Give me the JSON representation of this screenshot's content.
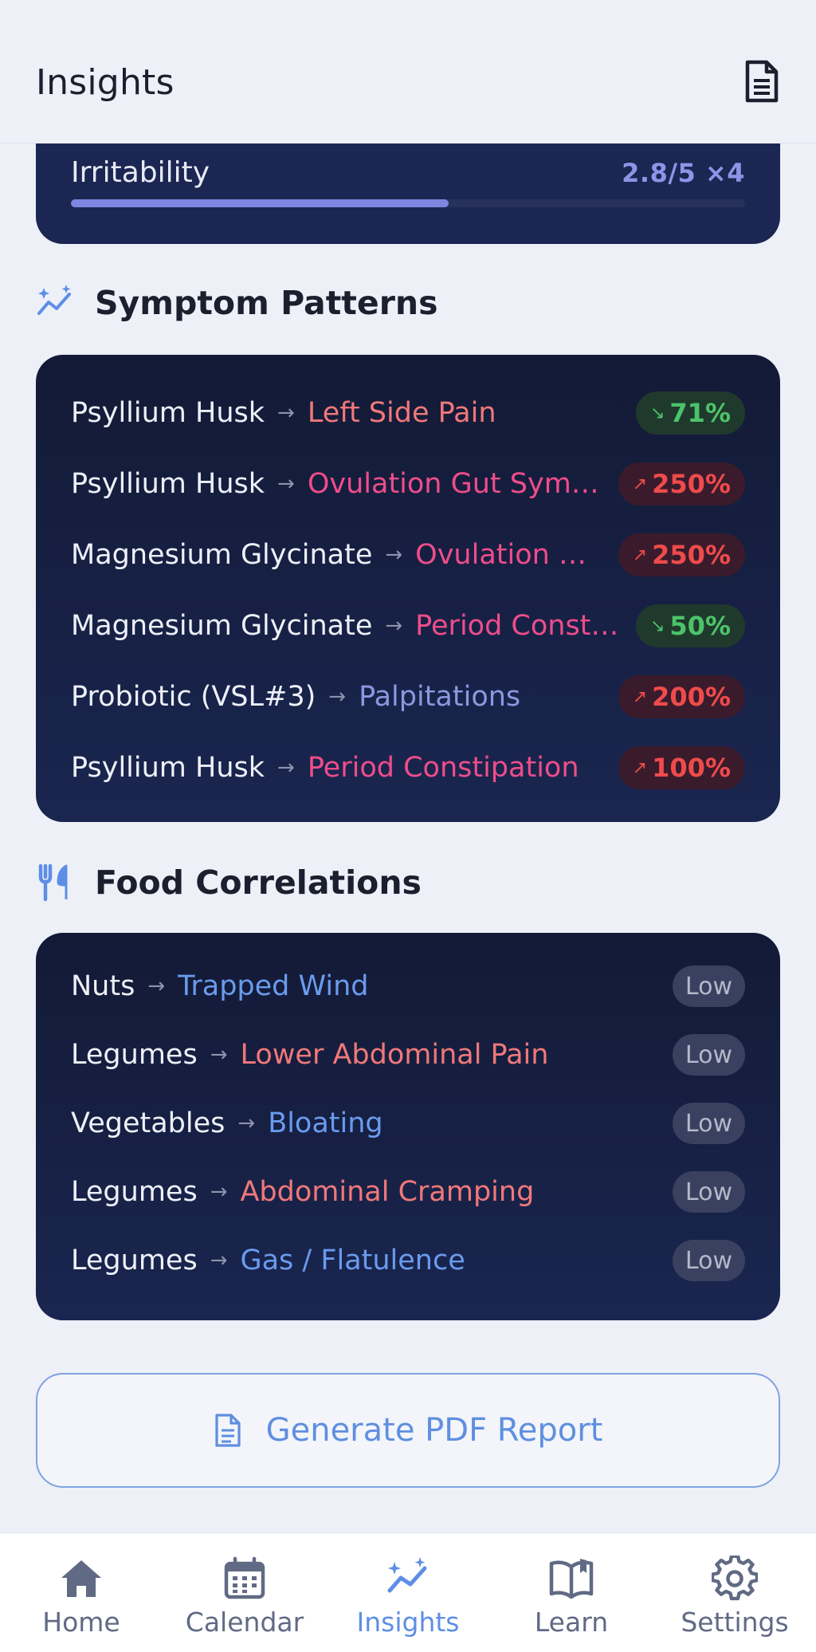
{
  "header": {
    "title": "Insights",
    "report_icon": "document-icon"
  },
  "mood_card": {
    "label": "Irritability",
    "value": "2.8/5 ×4",
    "progress_fraction": 0.56
  },
  "symptom_patterns": {
    "title": "Symptom Patterns",
    "icon": "sparkle-trend-icon",
    "rows": [
      {
        "source": "Psyllium Husk",
        "target": "Left Side Pain",
        "change": "71%",
        "direction": "down",
        "target_color": "#f0787a"
      },
      {
        "source": "Psyllium Husk",
        "target": "Ovulation Gut Symp...",
        "change": "250%",
        "direction": "up",
        "target_color": "#ee4d8a"
      },
      {
        "source": "Magnesium Glycinate",
        "target": "Ovulation G...",
        "change": "250%",
        "direction": "up",
        "target_color": "#ee4d8a"
      },
      {
        "source": "Magnesium Glycinate",
        "target": "Period Consti...",
        "change": "50%",
        "direction": "down",
        "target_color": "#ee4d8a"
      },
      {
        "source": "Probiotic (VSL#3)",
        "target": "Palpitations",
        "change": "200%",
        "direction": "up",
        "target_color": "#8d97e0"
      },
      {
        "source": "Psyllium Husk",
        "target": "Period Constipation",
        "change": "100%",
        "direction": "up",
        "target_color": "#ee4d8a"
      }
    ]
  },
  "food_correlations": {
    "title": "Food Correlations",
    "icon": "fork-knife-icon",
    "rows": [
      {
        "source": "Nuts",
        "target": "Trapped Wind",
        "level": "Low",
        "target_color": "#6a9bee"
      },
      {
        "source": "Legumes",
        "target": "Lower Abdominal Pain",
        "level": "Low",
        "target_color": "#f0787a"
      },
      {
        "source": "Vegetables",
        "target": "Bloating",
        "level": "Low",
        "target_color": "#6a9bee"
      },
      {
        "source": "Legumes",
        "target": "Abdominal Cramping",
        "level": "Low",
        "target_color": "#f0787a"
      },
      {
        "source": "Legumes",
        "target": "Gas / Flatulence",
        "level": "Low",
        "target_color": "#6a9bee"
      }
    ]
  },
  "pdf_button": {
    "label": "Generate PDF Report",
    "icon": "document-icon"
  },
  "tabbar": {
    "active": "Insights",
    "tabs": [
      {
        "label": "Home",
        "icon": "home-icon"
      },
      {
        "label": "Calendar",
        "icon": "calendar-icon"
      },
      {
        "label": "Insights",
        "icon": "insights-icon"
      },
      {
        "label": "Learn",
        "icon": "book-icon"
      },
      {
        "label": "Settings",
        "icon": "gear-icon"
      }
    ]
  },
  "colors": {
    "accent": "#5d8ee6",
    "card_bg": "#131a36",
    "up": "#ef4b4b",
    "down": "#4cc36a"
  }
}
